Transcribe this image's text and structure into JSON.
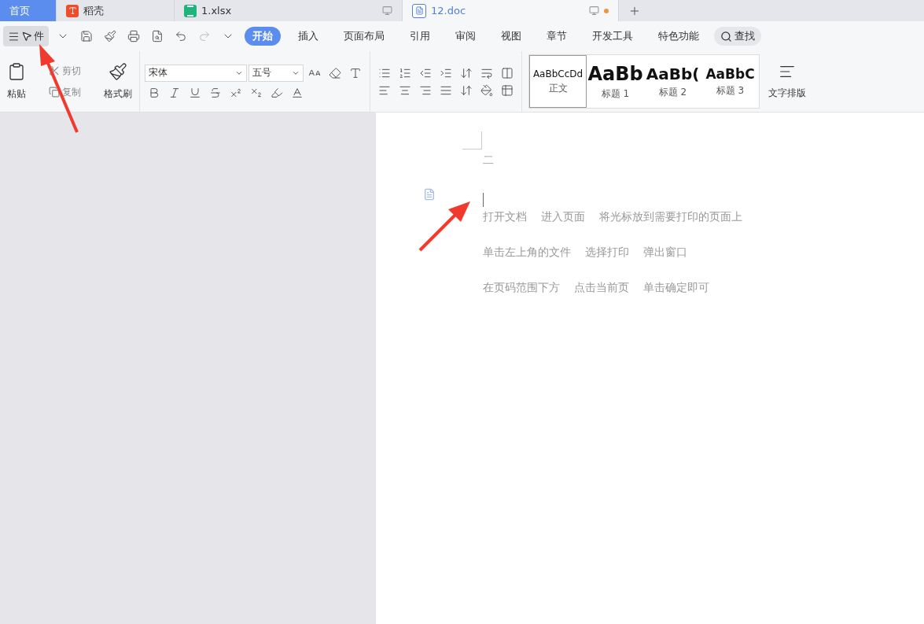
{
  "tabs": [
    {
      "label": "首页",
      "kind": "home",
      "selected": true
    },
    {
      "label": "稻壳",
      "kind": "docer",
      "selected": false
    },
    {
      "label": "1.xlsx",
      "kind": "sheet",
      "selected": false
    },
    {
      "label": "12.doc",
      "kind": "doc",
      "selected": false,
      "unsaved": true
    }
  ],
  "menu": {
    "label": "件"
  },
  "ribbon_tabs": [
    {
      "label": "开始",
      "selected": true
    },
    {
      "label": "插入",
      "selected": false
    },
    {
      "label": "页面布局",
      "selected": false
    },
    {
      "label": "引用",
      "selected": false
    },
    {
      "label": "审阅",
      "selected": false
    },
    {
      "label": "视图",
      "selected": false
    },
    {
      "label": "章节",
      "selected": false
    },
    {
      "label": "开发工具",
      "selected": false
    },
    {
      "label": "特色功能",
      "selected": false
    }
  ],
  "search": {
    "label": "查找"
  },
  "clipboard": {
    "paste": "粘贴",
    "cut": {
      "label": "剪切",
      "disabled": true
    },
    "copy": {
      "label": "复制",
      "disabled": true
    },
    "format_painter": "格式刷"
  },
  "font": {
    "name": "宋体",
    "size": "五号"
  },
  "styles": [
    {
      "preview": "AaBbCcDd",
      "label": "正文",
      "kind": "body",
      "selected": true
    },
    {
      "preview": "AaBb",
      "label": "标题 1",
      "kind": "h1",
      "selected": false
    },
    {
      "preview": "AaBb(",
      "label": "标题 2",
      "kind": "h2",
      "selected": false
    },
    {
      "preview": "AaBbC",
      "label": "标题 3",
      "kind": "h3",
      "selected": false
    }
  ],
  "text_layout": "文字排版",
  "document": {
    "heading": "二",
    "paragraphs": [
      [
        "打开文档",
        "进入页面",
        "将光标放到需要打印的页面上"
      ],
      [
        "单击左上角的文件",
        "选择打印",
        "弹出窗口"
      ],
      [
        "在页码范围下方",
        "点击当前页",
        "单击确定即可"
      ]
    ]
  }
}
